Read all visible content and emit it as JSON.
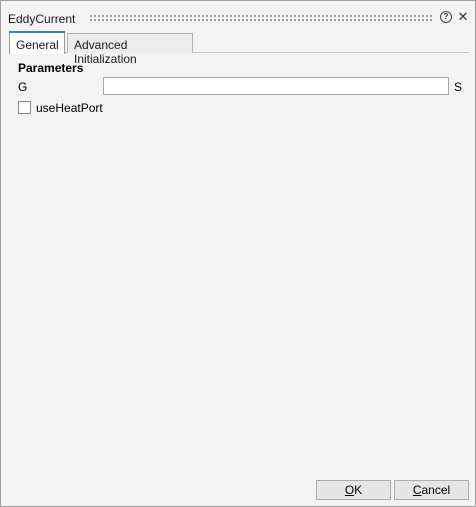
{
  "window": {
    "title": "EddyCurrent",
    "help_glyph": "?",
    "close_glyph": "✕"
  },
  "tabs": [
    {
      "label": "General",
      "selected": true
    },
    {
      "label": "Advanced Initialization",
      "selected": false
    }
  ],
  "parameters": {
    "section_title": "Parameters",
    "fields": [
      {
        "label": "G",
        "value": "",
        "unit": "S"
      }
    ],
    "checkboxes": [
      {
        "label": "useHeatPort",
        "checked": false
      }
    ]
  },
  "buttons": {
    "ok_mnemonic": "O",
    "ok_rest": "K",
    "cancel_mnemonic": "C",
    "cancel_rest": "ancel"
  },
  "colors": {
    "tab_accent": "#3b7dc4",
    "dialog_background": "#f3f3f3"
  }
}
